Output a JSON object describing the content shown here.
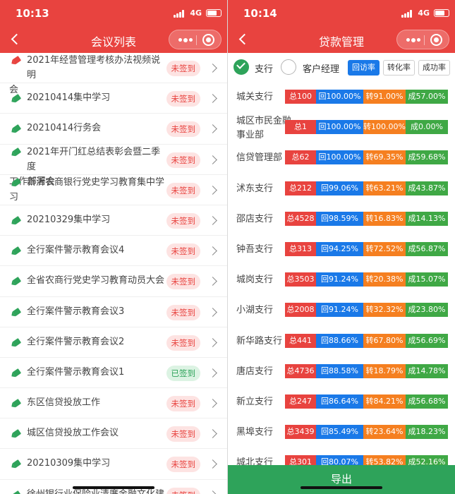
{
  "left": {
    "status": {
      "time": "10:13",
      "network": "4G"
    },
    "nav": {
      "title": "会议列表"
    },
    "meetings": [
      {
        "line1": "2021年经营管理考核办法视频说明",
        "line2": "会",
        "status": "未签到",
        "signed": false
      },
      {
        "line1": "20210414集中学习",
        "status": "未签到",
        "signed": false
      },
      {
        "line1": "20210414行务会",
        "status": "未签到",
        "signed": false
      },
      {
        "line1": "2021年开门红总结表彰会暨二季度",
        "line2": "工作部署会",
        "status": "未签到",
        "signed": false
      },
      {
        "line1": "新沂农商银行党史学习教育集中学",
        "line2": "习",
        "status": "未签到",
        "signed": false
      },
      {
        "line1": "20210329集中学习",
        "status": "未签到",
        "signed": false
      },
      {
        "line1": "全行案件警示教育会议4",
        "status": "未签到",
        "signed": false
      },
      {
        "line1": "全省农商行党史学习教育动员大会",
        "status": "未签到",
        "signed": false
      },
      {
        "line1": "全行案件警示教育会议3",
        "status": "未签到",
        "signed": false
      },
      {
        "line1": "全行案件警示教育会议2",
        "status": "未签到",
        "signed": false
      },
      {
        "line1": "全行案件警示教育会议1",
        "status": "已签到",
        "signed": true
      },
      {
        "line1": "东区信贷投放工作",
        "status": "未签到",
        "signed": false
      },
      {
        "line1": "城区信贷投放工作会议",
        "status": "未签到",
        "signed": false
      },
      {
        "line1": "20210309集中学习",
        "status": "未签到",
        "signed": false
      },
      {
        "line1": "徐州银行业保险业清廉金融文化建",
        "status": "未签到",
        "signed": false
      }
    ]
  },
  "right": {
    "status": {
      "time": "10:14",
      "network": "4G"
    },
    "nav": {
      "title": "贷款管理"
    },
    "filter": {
      "option_branch": "支行",
      "option_manager": "客户经理",
      "sort_visit": "回访率",
      "sort_convert": "转化率",
      "sort_success": "成功率"
    },
    "colors": {
      "total": "#e8433f",
      "visit": "#1a79e8",
      "convert": "#f57f20",
      "success": "#3fa845"
    },
    "branches": [
      {
        "name": "城关支行",
        "total": "总100",
        "visit": "回100.00%",
        "convert": "转91.00%",
        "success": "成57.00%"
      },
      {
        "name": "城区市民金融事业部",
        "line1": "城区市民金融",
        "line2": "事业部",
        "total": "总1",
        "visit": "回100.00%",
        "convert": "转100.00%",
        "success": "成0.00%"
      },
      {
        "name": "信贷管理部",
        "total": "总62",
        "visit": "回100.00%",
        "convert": "转69.35%",
        "success": "成59.68%"
      },
      {
        "name": "沭东支行",
        "total": "总212",
        "visit": "回99.06%",
        "convert": "转63.21%",
        "success": "成43.87%"
      },
      {
        "name": "邵店支行",
        "total": "总4528",
        "visit": "回98.59%",
        "convert": "转16.83%",
        "success": "成14.13%"
      },
      {
        "name": "钟吾支行",
        "total": "总313",
        "visit": "回94.25%",
        "convert": "转72.52%",
        "success": "成56.87%"
      },
      {
        "name": "城岗支行",
        "total": "总3503",
        "visit": "回91.24%",
        "convert": "转20.38%",
        "success": "成15.07%"
      },
      {
        "name": "小湖支行",
        "total": "总2008",
        "visit": "回91.24%",
        "convert": "转32.32%",
        "success": "成23.80%"
      },
      {
        "name": "新华路支行",
        "total": "总441",
        "visit": "回88.66%",
        "convert": "转67.80%",
        "success": "成56.69%"
      },
      {
        "name": "唐店支行",
        "total": "总4736",
        "visit": "回88.58%",
        "convert": "转18.79%",
        "success": "成14.78%"
      },
      {
        "name": "新立支行",
        "total": "总247",
        "visit": "回86.64%",
        "convert": "转84.21%",
        "success": "成56.68%"
      },
      {
        "name": "黑埠支行",
        "total": "总3439",
        "visit": "回85.49%",
        "convert": "转23.64%",
        "success": "成18.23%"
      },
      {
        "name": "城北支行",
        "total": "总301",
        "visit": "回80.07%",
        "convert": "转53.82%",
        "success": "成52.16%"
      }
    ],
    "export_label": "导出"
  }
}
